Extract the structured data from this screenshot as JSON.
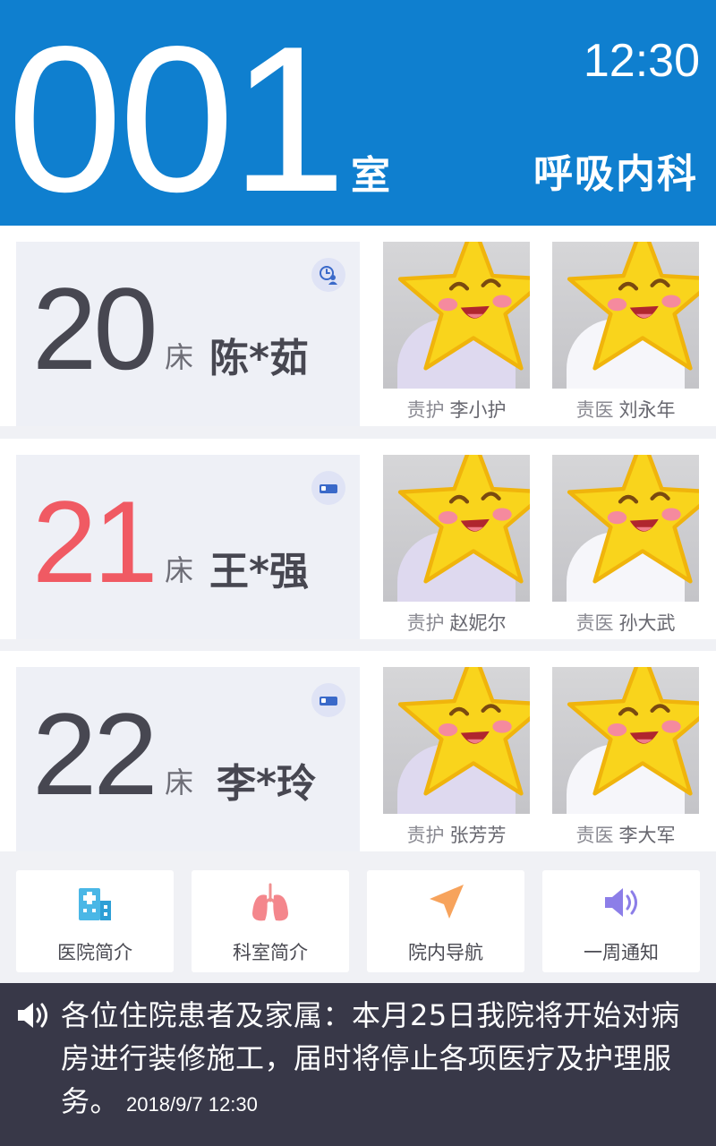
{
  "header": {
    "room_number": "001",
    "room_suffix": "室",
    "time": "12:30",
    "department": "呼吸内科"
  },
  "beds": [
    {
      "number": "20",
      "unit": "床",
      "patient": "陈*茹",
      "status_icon": "clock-person-icon",
      "alert": false,
      "nurse": {
        "role": "责护",
        "name": "李小护"
      },
      "doctor": {
        "role": "责医",
        "name": "刘永年"
      }
    },
    {
      "number": "21",
      "unit": "床",
      "patient": "王*强",
      "status_icon": "bed-icon",
      "alert": true,
      "nurse": {
        "role": "责护",
        "name": "赵妮尔"
      },
      "doctor": {
        "role": "责医",
        "name": "孙大武"
      }
    },
    {
      "number": "22",
      "unit": "床",
      "patient": "李*玲",
      "status_icon": "bed-icon",
      "alert": false,
      "nurse": {
        "role": "责护",
        "name": "张芳芳"
      },
      "doctor": {
        "role": "责医",
        "name": "李大军"
      }
    }
  ],
  "quick_links": [
    {
      "label": "医院简介",
      "icon": "hospital-icon"
    },
    {
      "label": "科室简介",
      "icon": "lungs-icon"
    },
    {
      "label": "院内导航",
      "icon": "navigation-arrow-icon"
    },
    {
      "label": "一周通知",
      "icon": "speaker-icon"
    }
  ],
  "notice": {
    "text": "各位住院患者及家属：本月25日我院将开始对病房进行装修施工，届时将停止各项医疗及护理服务。",
    "timestamp": "2018/9/7 12:30"
  },
  "colors": {
    "header_bg": "#0f7fcf",
    "alert_number": "#f05a63",
    "notice_bg": "#383848"
  }
}
